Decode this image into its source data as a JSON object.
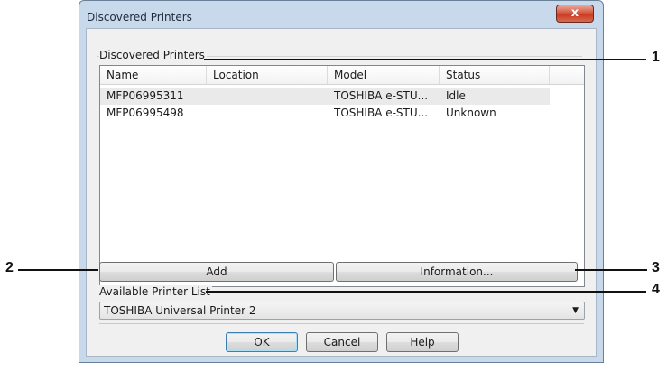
{
  "window": {
    "title": "Discovered Printers",
    "close_glyph": "x"
  },
  "discovered_group": {
    "label": "Discovered Printers",
    "columns": [
      "Name",
      "Location",
      "Model",
      "Status"
    ],
    "rows": [
      {
        "name": "MFP06995311",
        "location": "",
        "model": "TOSHIBA e-STU...",
        "status": "Idle",
        "selected": true
      },
      {
        "name": "MFP06995498",
        "location": "",
        "model": "TOSHIBA e-STU...",
        "status": "Unknown",
        "selected": false
      }
    ]
  },
  "buttons": {
    "add": "Add",
    "information": "Information...",
    "ok": "OK",
    "cancel": "Cancel",
    "help": "Help"
  },
  "available": {
    "label": "Available Printer List",
    "selected_value": "TOSHIBA Universal Printer 2"
  },
  "callouts": {
    "c1": "1",
    "c2": "2",
    "c3": "3",
    "c4": "4"
  },
  "colors": {
    "accent": "#3c7fb1",
    "close_button": "#c7381d"
  }
}
